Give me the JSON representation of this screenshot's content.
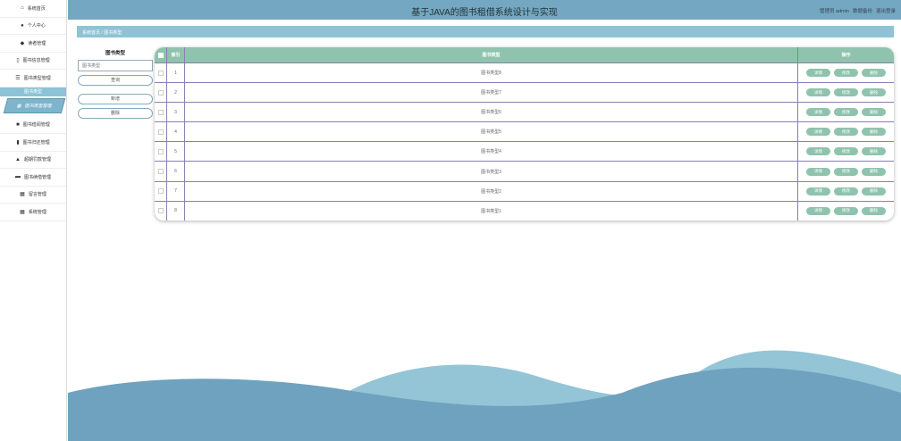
{
  "header": {
    "title": "基于JAVA的图书租借系统设计与实现",
    "admin": "管理员 admin",
    "backup": "数据备份",
    "logout": "退出登录"
  },
  "sidebar": {
    "items_top": [
      {
        "icon": "home-icon",
        "glyph": "⌂",
        "label": "系统首页"
      },
      {
        "icon": "user-icon",
        "glyph": "●",
        "label": "个人中心"
      },
      {
        "icon": "pin-icon",
        "glyph": "◆",
        "label": "读者管理"
      },
      {
        "icon": "book-icon",
        "glyph": "▯",
        "label": "图书信息管理"
      },
      {
        "icon": "list-icon",
        "glyph": "☰",
        "label": "图书类型管理"
      }
    ],
    "group": "图书类型",
    "sub": "图书类型管理",
    "items_bottom": [
      {
        "icon": "clipboard-icon",
        "glyph": "■",
        "label": "图书借阅管理"
      },
      {
        "icon": "chart-icon",
        "glyph": "▮",
        "label": "图书归还管理"
      },
      {
        "icon": "person-icon",
        "glyph": "▲",
        "label": "超期罚款管理"
      },
      {
        "icon": "monitor-icon",
        "glyph": "▬",
        "label": "图书续借管理"
      },
      {
        "icon": "grid-icon",
        "glyph": "▦",
        "label": "留言管理"
      },
      {
        "icon": "grid-icon",
        "glyph": "▦",
        "label": "系统管理"
      }
    ]
  },
  "breadcrumb": {
    "home": "系统首页",
    "sep": "/",
    "current": "图书类型"
  },
  "search": {
    "label": "图书类型",
    "placeholder": "图书类型",
    "query": "查询",
    "add": "新增",
    "delete": "删除"
  },
  "table": {
    "headers": [
      "",
      "索引",
      "图书类型",
      "操作"
    ],
    "rows": [
      {
        "index": "1",
        "type": "图书类型8"
      },
      {
        "index": "2",
        "type": "图书类型7"
      },
      {
        "index": "3",
        "type": "图书类型6"
      },
      {
        "index": "4",
        "type": "图书类型5"
      },
      {
        "index": "5",
        "type": "图书类型4"
      },
      {
        "index": "6",
        "type": "图书类型3"
      },
      {
        "index": "7",
        "type": "图书类型2"
      },
      {
        "index": "8",
        "type": "图书类型1"
      }
    ],
    "actions": {
      "detail": "详情",
      "edit": "修改",
      "delete": "删除"
    }
  },
  "colors": {
    "header": "#74a7c2",
    "table_header": "#8fc3ad",
    "crumb": "#8ec3d6"
  }
}
